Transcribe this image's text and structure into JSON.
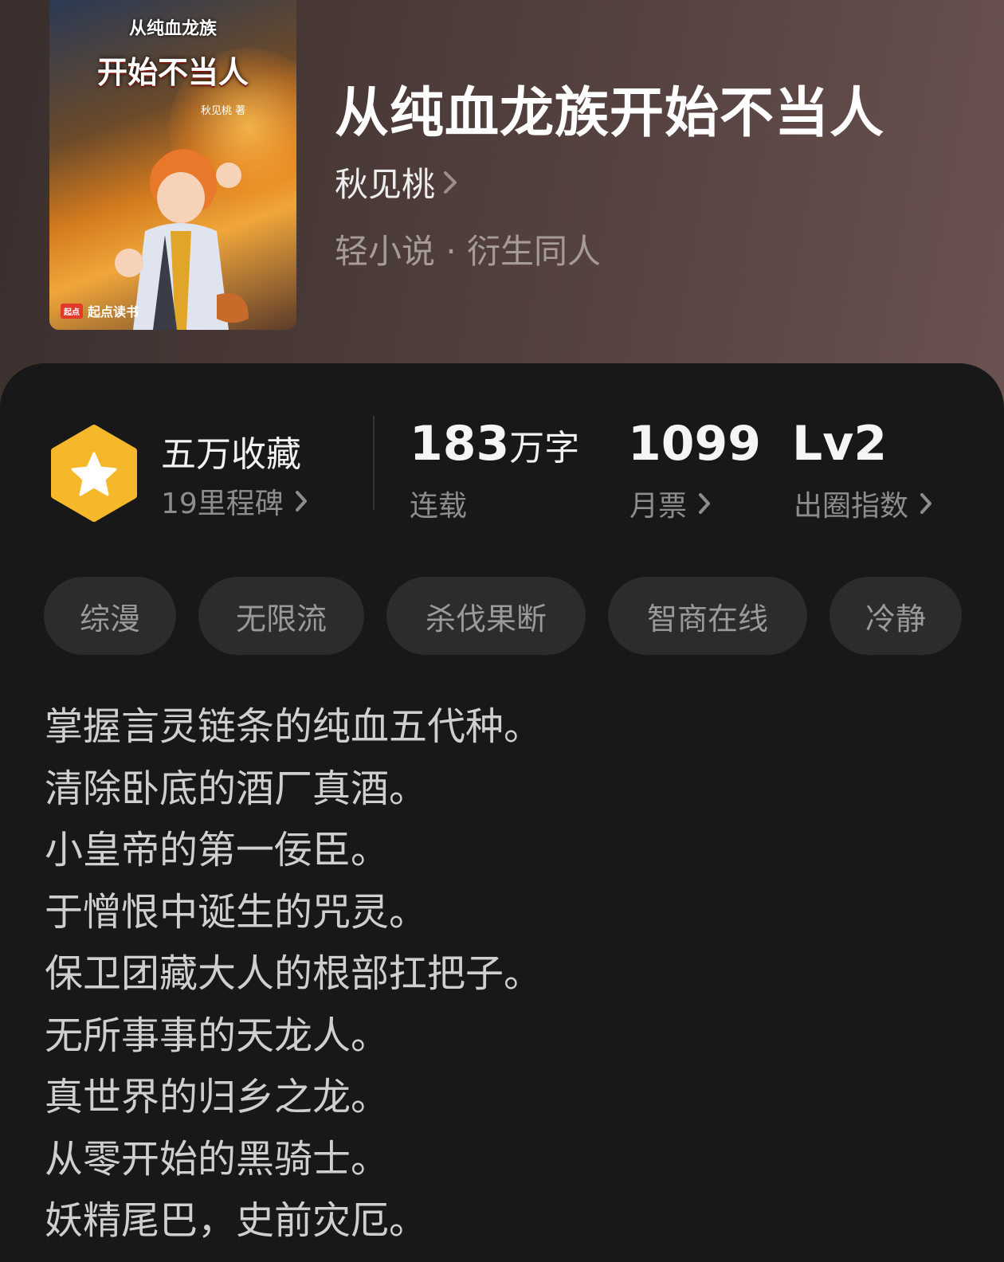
{
  "book": {
    "title": "从纯血龙族开始不当人",
    "author": "秋见桃",
    "category": "轻小说 · 衍生同人"
  },
  "cover": {
    "series_text": "从纯血龙族",
    "title_text": "开始不当人",
    "author_text": "秋见桃 著",
    "publisher_badge": "起点",
    "publisher": "起点读书"
  },
  "stats": {
    "favorites": "五万收藏",
    "milestone": "19里程碑",
    "word_count_number": "183",
    "word_count_unit": "万字",
    "status": "连载",
    "monthly_tickets": "1099",
    "monthly_tickets_label": "月票",
    "level": "Lv2",
    "level_label": "出圈指数"
  },
  "tags": [
    "综漫",
    "无限流",
    "杀伐果断",
    "智商在线",
    "冷静"
  ],
  "description": [
    "掌握言灵链条的纯血五代种。",
    "清除卧底的酒厂真酒。",
    "小皇帝的第一佞臣。",
    "于憎恨中诞生的咒灵。",
    "保卫团藏大人的根部扛把子。",
    "无所事事的天龙人。",
    "真世界的归乡之龙。",
    "从零开始的黑骑士。",
    "妖精尾巴，史前灾厄。"
  ],
  "colors": {
    "background": "#181818",
    "badge_gold": "#f5b82a",
    "tag_bg": "#2c2c2c"
  },
  "icons": [
    "star-hexagon-icon",
    "chevron-right-icon"
  ]
}
